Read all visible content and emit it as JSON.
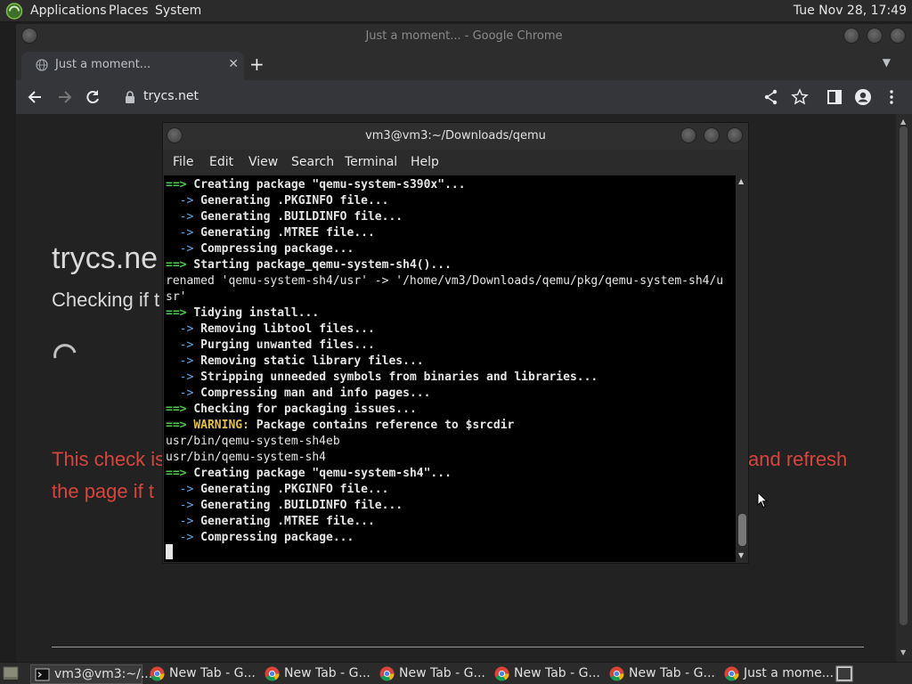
{
  "top_panel": {
    "menus": [
      "Applications",
      "Places",
      "System"
    ],
    "clock": "Tue Nov 28, 17:49"
  },
  "chrome": {
    "window_title": "Just a moment... - Google Chrome",
    "tab_label": "Just a moment...",
    "url": "trycs.net"
  },
  "site": {
    "heading": "trycs.ne",
    "subheading": "Checking if t",
    "warning_left_1": "This check is",
    "warning_left_2": "the page if t",
    "warning_right": "and refresh"
  },
  "terminal": {
    "title": "vm3@vm3:~/Downloads/qemu",
    "menu": [
      "File",
      "Edit",
      "View",
      "Search",
      "Terminal",
      "Help"
    ],
    "lines": [
      {
        "pre": "==> ",
        "text": "Creating package \"qemu-system-s390x\"...",
        "kind": "head"
      },
      {
        "pre": "  -> ",
        "text": "Generating .PKGINFO file...",
        "kind": "sub"
      },
      {
        "pre": "  -> ",
        "text": "Generating .BUILDINFO file...",
        "kind": "sub"
      },
      {
        "pre": "  -> ",
        "text": "Generating .MTREE file...",
        "kind": "sub"
      },
      {
        "pre": "  -> ",
        "text": "Compressing package...",
        "kind": "sub"
      },
      {
        "pre": "==> ",
        "text": "Starting package_qemu-system-sh4()...",
        "kind": "head"
      },
      {
        "pre": "",
        "text": "renamed 'qemu-system-sh4/usr' -> '/home/vm3/Downloads/qemu/pkg/qemu-system-sh4/u",
        "kind": "plain"
      },
      {
        "pre": "",
        "text": "sr'",
        "kind": "plain"
      },
      {
        "pre": "==> ",
        "text": "Tidying install...",
        "kind": "head"
      },
      {
        "pre": "  -> ",
        "text": "Removing libtool files...",
        "kind": "sub"
      },
      {
        "pre": "  -> ",
        "text": "Purging unwanted files...",
        "kind": "sub"
      },
      {
        "pre": "  -> ",
        "text": "Removing static library files...",
        "kind": "sub"
      },
      {
        "pre": "  -> ",
        "text": "Stripping unneeded symbols from binaries and libraries...",
        "kind": "sub"
      },
      {
        "pre": "  -> ",
        "text": "Compressing man and info pages...",
        "kind": "sub"
      },
      {
        "pre": "==> ",
        "text": "Checking for packaging issues...",
        "kind": "head"
      },
      {
        "pre": "==> ",
        "warn": "WARNING:",
        "text": " Package contains reference to $srcdir",
        "kind": "warn"
      },
      {
        "pre": "",
        "text": "usr/bin/qemu-system-sh4eb",
        "kind": "plain"
      },
      {
        "pre": "",
        "text": "usr/bin/qemu-system-sh4",
        "kind": "plain"
      },
      {
        "pre": "==> ",
        "text": "Creating package \"qemu-system-sh4\"...",
        "kind": "head"
      },
      {
        "pre": "  -> ",
        "text": "Generating .PKGINFO file...",
        "kind": "sub"
      },
      {
        "pre": "  -> ",
        "text": "Generating .BUILDINFO file...",
        "kind": "sub"
      },
      {
        "pre": "  -> ",
        "text": "Generating .MTREE file...",
        "kind": "sub"
      },
      {
        "pre": "  -> ",
        "text": "Compressing package...",
        "kind": "sub"
      }
    ]
  },
  "taskbar": [
    {
      "label": "vm3@vm3:~/...",
      "icon": "terminal-icon",
      "active": true
    },
    {
      "label": "New Tab - G...",
      "icon": "chrome-icon",
      "active": false
    },
    {
      "label": "New Tab - G...",
      "icon": "chrome-icon",
      "active": false
    },
    {
      "label": "New Tab - G...",
      "icon": "chrome-icon",
      "active": false
    },
    {
      "label": "New Tab - G...",
      "icon": "chrome-icon",
      "active": false
    },
    {
      "label": "New Tab - G...",
      "icon": "chrome-icon",
      "active": false
    },
    {
      "label": "Just a mome...",
      "icon": "chrome-icon",
      "active": false
    }
  ],
  "colors": {
    "arrow_green": "#4ec94e",
    "warning_yellow": "#e0c24c",
    "site_warning_red": "#d6453d"
  }
}
